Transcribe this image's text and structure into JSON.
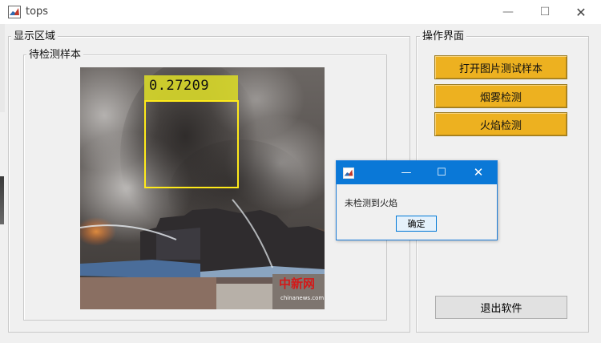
{
  "window": {
    "title": "tops",
    "controls": {
      "minimize": "—",
      "maximize": "☐",
      "close": "✕"
    }
  },
  "display_panel": {
    "title": "显示区域"
  },
  "sample_panel": {
    "title": "待检测样本"
  },
  "detection": {
    "score": "0.27209",
    "box_color": "#ffea1a",
    "label_color": "#d6d62a"
  },
  "image": {
    "watermark": "中新网",
    "watermark_sub": "chinanews.com"
  },
  "operations_panel": {
    "title": "操作界面",
    "buttons": {
      "open_image": "打开图片测试样本",
      "smoke_detect": "烟雾检测",
      "fire_detect": "火焰检测",
      "exit": "退出软件"
    },
    "accent_color": "#edb120"
  },
  "dialog": {
    "controls": {
      "minimize": "—",
      "maximize": "☐",
      "close": "✕"
    },
    "message": "未检测到火焰",
    "ok_label": "确定",
    "titlebar_color": "#0a78d7"
  }
}
